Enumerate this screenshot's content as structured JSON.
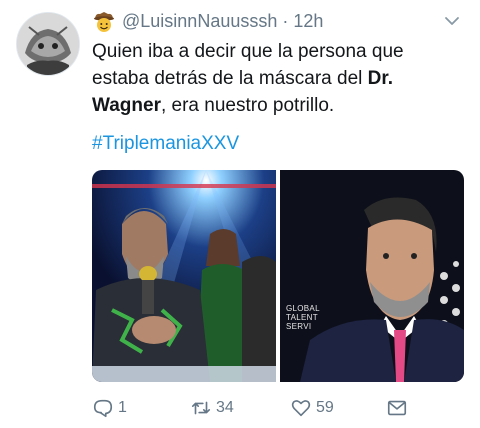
{
  "tweet": {
    "handle": "@LuisinnNauusssh",
    "separator": "·",
    "time": "12h",
    "text_1": "Quien iba a decir que la persona que estaba detrás de la máscara del ",
    "text_bold": "Dr. Wagner",
    "text_2": ", era nuestro potrillo.",
    "hashtag": "#TriplemaniaXXV",
    "watermark_line1": "GLOBAL",
    "watermark_line2": "TALENT",
    "watermark_line3": "SERVI"
  },
  "actions": {
    "reply_count": "1",
    "retweet_count": "34",
    "like_count": "59"
  },
  "icons": {
    "header_emoji": "cowboy-emoji-icon",
    "menu": "chevron-down-icon",
    "reply": "reply-icon",
    "retweet": "retweet-icon",
    "like": "heart-icon",
    "dm": "envelope-icon"
  },
  "colors": {
    "link": "#1b95e0",
    "secondary_text": "#657786",
    "primary_text": "#14171a"
  }
}
